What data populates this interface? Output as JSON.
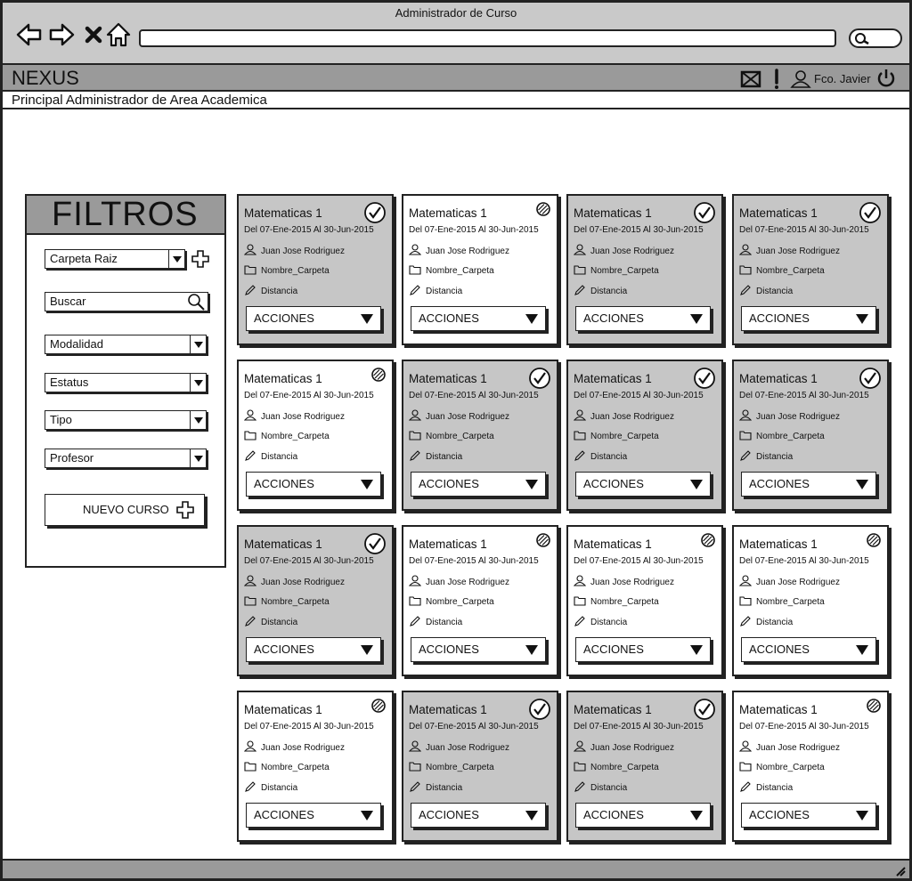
{
  "window": {
    "title": "Administrador de Curso"
  },
  "header": {
    "brand": "NEXUS",
    "user_name": "Fco. Javier"
  },
  "breadcrumb": "Principal Administrador de Area Academica",
  "filters": {
    "title": "FILTROS",
    "carpeta": "Carpeta Raiz",
    "buscar": "Buscar",
    "modalidad": "Modalidad",
    "estatus": "Estatus",
    "tipo": "Tipo",
    "profesor": "Profesor",
    "nuevo_curso": "NUEVO CURSO"
  },
  "courses": [
    {
      "title": "Matematicas 1",
      "dates": "Del 07-Ene-2015 Al 30-Jun-2015",
      "teacher": "Juan Jose Rodriguez",
      "folder": "Nombre_Carpeta",
      "mode": "Distancia",
      "status": "active",
      "actions": "ACCIONES"
    },
    {
      "title": "Matematicas 1",
      "dates": "Del 07-Ene-2015 Al 30-Jun-2015",
      "teacher": "Juan Jose Rodriguez",
      "folder": "Nombre_Carpeta",
      "mode": "Distancia",
      "status": "inactive",
      "actions": "ACCIONES"
    },
    {
      "title": "Matematicas 1",
      "dates": "Del 07-Ene-2015 Al 30-Jun-2015",
      "teacher": "Juan Jose Rodriguez",
      "folder": "Nombre_Carpeta",
      "mode": "Distancia",
      "status": "active",
      "actions": "ACCIONES"
    },
    {
      "title": "Matematicas 1",
      "dates": "Del 07-Ene-2015 Al 30-Jun-2015",
      "teacher": "Juan Jose Rodriguez",
      "folder": "Nombre_Carpeta",
      "mode": "Distancia",
      "status": "active",
      "actions": "ACCIONES"
    },
    {
      "title": "Matematicas 1",
      "dates": "Del 07-Ene-2015 Al 30-Jun-2015",
      "teacher": "Juan Jose Rodriguez",
      "folder": "Nombre_Carpeta",
      "mode": "Distancia",
      "status": "inactive",
      "actions": "ACCIONES"
    },
    {
      "title": "Matematicas 1",
      "dates": "Del 07-Ene-2015 Al 30-Jun-2015",
      "teacher": "Juan Jose Rodriguez",
      "folder": "Nombre_Carpeta",
      "mode": "Distancia",
      "status": "active",
      "actions": "ACCIONES"
    },
    {
      "title": "Matematicas 1",
      "dates": "Del 07-Ene-2015 Al 30-Jun-2015",
      "teacher": "Juan Jose Rodriguez",
      "folder": "Nombre_Carpeta",
      "mode": "Distancia",
      "status": "active",
      "actions": "ACCIONES"
    },
    {
      "title": "Matematicas 1",
      "dates": "Del 07-Ene-2015 Al 30-Jun-2015",
      "teacher": "Juan Jose Rodriguez",
      "folder": "Nombre_Carpeta",
      "mode": "Distancia",
      "status": "active",
      "actions": "ACCIONES"
    },
    {
      "title": "Matematicas 1",
      "dates": "Del 07-Ene-2015 Al 30-Jun-2015",
      "teacher": "Juan Jose Rodriguez",
      "folder": "Nombre_Carpeta",
      "mode": "Distancia",
      "status": "active",
      "actions": "ACCIONES"
    },
    {
      "title": "Matematicas 1",
      "dates": "Del 07-Ene-2015 Al 30-Jun-2015",
      "teacher": "Juan Jose Rodriguez",
      "folder": "Nombre_Carpeta",
      "mode": "Distancia",
      "status": "inactive",
      "actions": "ACCIONES"
    },
    {
      "title": "Matematicas 1",
      "dates": "Del 07-Ene-2015 Al 30-Jun-2015",
      "teacher": "Juan Jose Rodriguez",
      "folder": "Nombre_Carpeta",
      "mode": "Distancia",
      "status": "inactive",
      "actions": "ACCIONES"
    },
    {
      "title": "Matematicas 1",
      "dates": "Del 07-Ene-2015 Al 30-Jun-2015",
      "teacher": "Juan Jose Rodriguez",
      "folder": "Nombre_Carpeta",
      "mode": "Distancia",
      "status": "inactive",
      "actions": "ACCIONES"
    },
    {
      "title": "Matematicas 1",
      "dates": "Del 07-Ene-2015 Al 30-Jun-2015",
      "teacher": "Juan Jose Rodriguez",
      "folder": "Nombre_Carpeta",
      "mode": "Distancia",
      "status": "inactive",
      "actions": "ACCIONES"
    },
    {
      "title": "Matematicas 1",
      "dates": "Del 07-Ene-2015 Al 30-Jun-2015",
      "teacher": "Juan Jose Rodriguez",
      "folder": "Nombre_Carpeta",
      "mode": "Distancia",
      "status": "active",
      "actions": "ACCIONES"
    },
    {
      "title": "Matematicas 1",
      "dates": "Del 07-Ene-2015 Al 30-Jun-2015",
      "teacher": "Juan Jose Rodriguez",
      "folder": "Nombre_Carpeta",
      "mode": "Distancia",
      "status": "active",
      "actions": "ACCIONES"
    },
    {
      "title": "Matematicas 1",
      "dates": "Del 07-Ene-2015 Al 30-Jun-2015",
      "teacher": "Juan Jose Rodriguez",
      "folder": "Nombre_Carpeta",
      "mode": "Distancia",
      "status": "inactive",
      "actions": "ACCIONES"
    }
  ],
  "colors": {
    "active_card": "#c6c6c6",
    "inactive_card": "#ffffff",
    "bar": "#9a9a9a"
  }
}
